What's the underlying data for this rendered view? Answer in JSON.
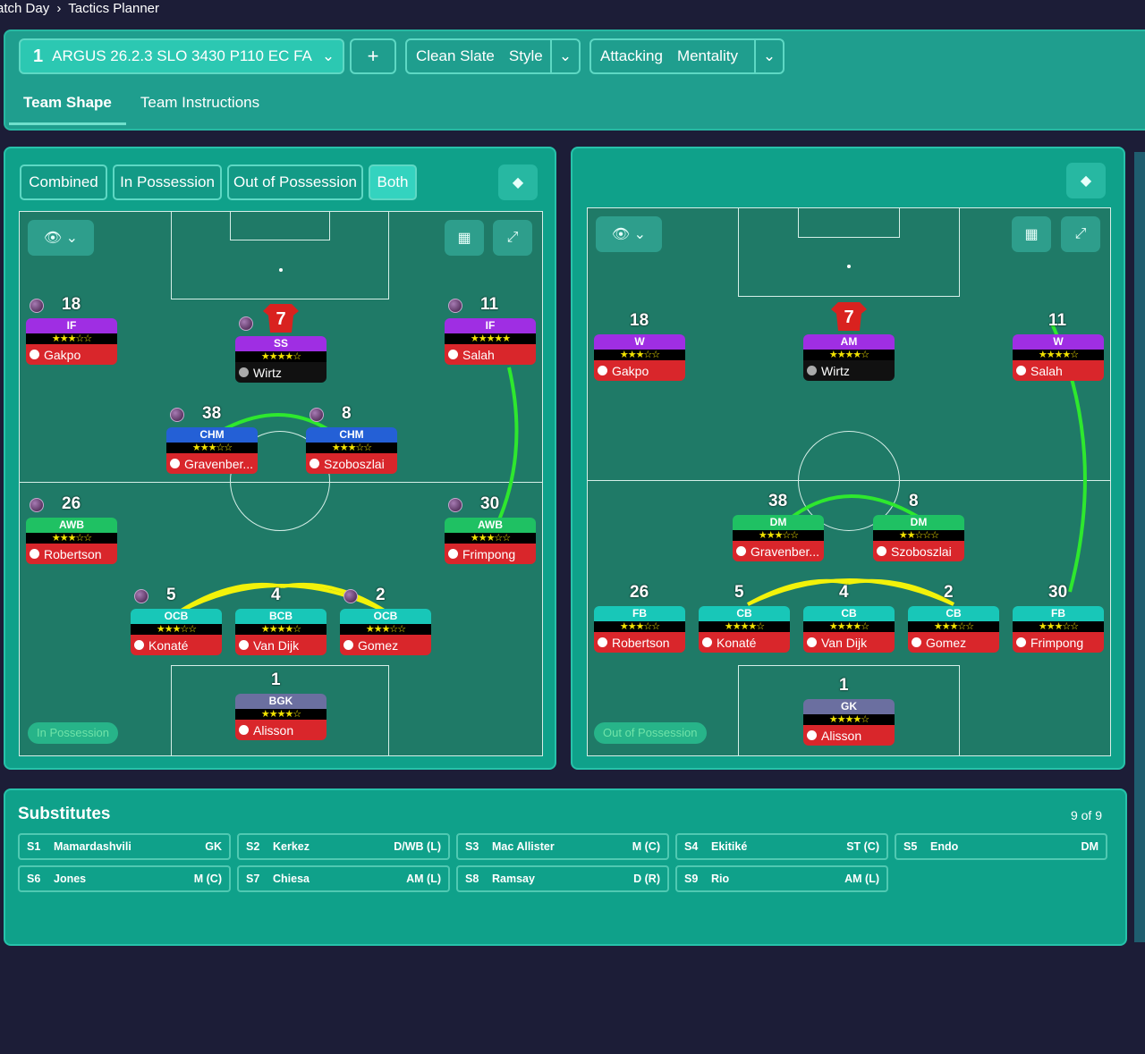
{
  "breadcrumb": {
    "first": "atch Day",
    "sep": "›",
    "second": "Tactics Planner"
  },
  "header": {
    "tactic_number": "1",
    "tactic_name": "ARGUS 26.2.3 SLO 3430 P110 EC FA",
    "add": "+",
    "style_a": "Clean Slate",
    "style_b": "Style",
    "mentality_a": "Attacking",
    "mentality_b": "Mentality"
  },
  "tabs": [
    "Team Shape",
    "Team Instructions"
  ],
  "view_buttons": [
    "Combined",
    "In Possession",
    "Out of Possession",
    "Both"
  ],
  "left_pitch": {
    "label": "In Possession",
    "players": [
      {
        "num": "18",
        "role": "IF",
        "stars": "★★★☆☆",
        "name": "Gakpo",
        "role_color": "#9f2ee3"
      },
      {
        "num": "7",
        "role": "SS",
        "stars": "★★★★☆",
        "name": "Wirtz",
        "role_color": "#9f2ee3"
      },
      {
        "num": "11",
        "role": "IF",
        "stars": "★★★★★",
        "name": "Salah",
        "role_color": "#9f2ee3"
      },
      {
        "num": "38",
        "role": "CHM",
        "stars": "★★★☆☆",
        "name": "Gravenber...",
        "role_color": "#2460d6"
      },
      {
        "num": "8",
        "role": "CHM",
        "stars": "★★★☆☆",
        "name": "Szoboszlai",
        "role_color": "#2460d6"
      },
      {
        "num": "26",
        "role": "AWB",
        "stars": "★★★☆☆",
        "name": "Robertson",
        "role_color": "#1fc163"
      },
      {
        "num": "30",
        "role": "AWB",
        "stars": "★★★☆☆",
        "name": "Frimpong",
        "role_color": "#1fc163"
      },
      {
        "num": "5",
        "role": "OCB",
        "stars": "★★★☆☆",
        "name": "Konaté",
        "role_color": "#18c7b8"
      },
      {
        "num": "4",
        "role": "BCB",
        "stars": "★★★★☆",
        "name": "Van Dijk",
        "role_color": "#18c7b8"
      },
      {
        "num": "2",
        "role": "OCB",
        "stars": "★★★☆☆",
        "name": "Gomez",
        "role_color": "#18c7b8"
      },
      {
        "num": "1",
        "role": "BGK",
        "stars": "★★★★☆",
        "name": "Alisson",
        "role_color": "#6b6fa0"
      }
    ]
  },
  "right_pitch": {
    "label": "Out of Possession",
    "players": [
      {
        "num": "18",
        "role": "W",
        "stars": "★★★☆☆",
        "name": "Gakpo",
        "role_color": "#9f2ee3"
      },
      {
        "num": "7",
        "role": "AM",
        "stars": "★★★★☆",
        "name": "Wirtz",
        "role_color": "#9f2ee3"
      },
      {
        "num": "11",
        "role": "W",
        "stars": "★★★★☆",
        "name": "Salah",
        "role_color": "#9f2ee3"
      },
      {
        "num": "38",
        "role": "DM",
        "stars": "★★★☆☆",
        "name": "Gravenber...",
        "role_color": "#1fc163"
      },
      {
        "num": "8",
        "role": "DM",
        "stars": "★★☆☆☆",
        "name": "Szoboszlai",
        "role_color": "#1fc163"
      },
      {
        "num": "26",
        "role": "FB",
        "stars": "★★★☆☆",
        "name": "Robertson",
        "role_color": "#18c7b8"
      },
      {
        "num": "5",
        "role": "CB",
        "stars": "★★★★☆",
        "name": "Konaté",
        "role_color": "#18c7b8"
      },
      {
        "num": "4",
        "role": "CB",
        "stars": "★★★★☆",
        "name": "Van Dijk",
        "role_color": "#18c7b8"
      },
      {
        "num": "2",
        "role": "CB",
        "stars": "★★★☆☆",
        "name": "Gomez",
        "role_color": "#18c7b8"
      },
      {
        "num": "30",
        "role": "FB",
        "stars": "★★★☆☆",
        "name": "Frimpong",
        "role_color": "#18c7b8"
      },
      {
        "num": "1",
        "role": "GK",
        "stars": "★★★★☆",
        "name": "Alisson",
        "role_color": "#6b6fa0"
      }
    ]
  },
  "substitutes": {
    "title": "Substitutes",
    "count": "9 of 9",
    "items": [
      {
        "slot": "S1",
        "name": "Mamardashvili",
        "pos": "GK"
      },
      {
        "slot": "S2",
        "name": "Kerkez",
        "pos": "D/WB (L)"
      },
      {
        "slot": "S3",
        "name": "Mac Allister",
        "pos": "M (C)"
      },
      {
        "slot": "S4",
        "name": "Ekitiké",
        "pos": "ST (C)"
      },
      {
        "slot": "S5",
        "name": "Endo",
        "pos": "DM"
      },
      {
        "slot": "S6",
        "name": "Jones",
        "pos": "M (C)"
      },
      {
        "slot": "S7",
        "name": "Chiesa",
        "pos": "AM (L)"
      },
      {
        "slot": "S8",
        "name": "Ramsay",
        "pos": "D (R)"
      },
      {
        "slot": "S9",
        "name": "Rio",
        "pos": "AM (L)"
      }
    ]
  },
  "colors": {
    "name_bar": "#d9262b",
    "panel": "#0fa18a",
    "pitch": "#1f7a67",
    "link_green": "#2ee82e",
    "link_yellow": "#f2f20a"
  }
}
